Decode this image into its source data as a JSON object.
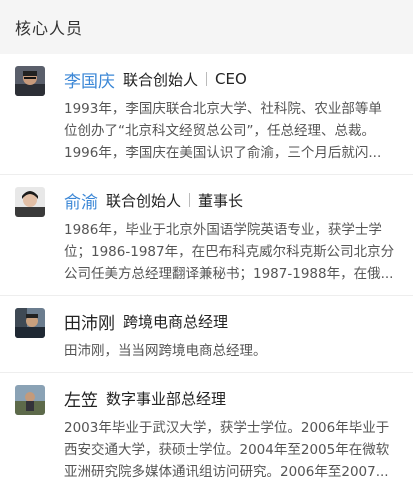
{
  "section": {
    "title": "核心人员"
  },
  "people": [
    {
      "name": "李国庆",
      "roles": [
        "联合创始人",
        "CEO"
      ],
      "bio_lines": [
        "1993年，李国庆联合北京大学、社科院、农业部等单",
        "位创办了“北京科文经贸总公司”，任总经理、总裁。",
        "1996年，李国庆在美国认识了俞渝，三个月后就闪..."
      ]
    },
    {
      "name": "俞渝",
      "roles": [
        "联合创始人",
        "董事长"
      ],
      "bio_lines": [
        "1986年，毕业于北京外国语学院英语专业，获学士学",
        "位；1986-1987年，在巴布科克威尔科克斯公司北京分",
        "公司任美方总经理翻译兼秘书；1987-1988年，在俄..."
      ]
    },
    {
      "name": "田沛刚",
      "roles": [
        "跨境电商总经理"
      ],
      "bio_lines": [
        "田沛刚，当当网跨境电商总经理。"
      ]
    },
    {
      "name": "左笠",
      "roles": [
        "数字事业部总经理"
      ],
      "bio_lines": [
        "2003年毕业于武汉大学，获学士学位。2006年毕业于",
        "西安交通大学，获硕士学位。2004年至2005年在微软",
        "亚洲研究院多媒体通讯组访问研究。2006年至2007..."
      ]
    }
  ]
}
